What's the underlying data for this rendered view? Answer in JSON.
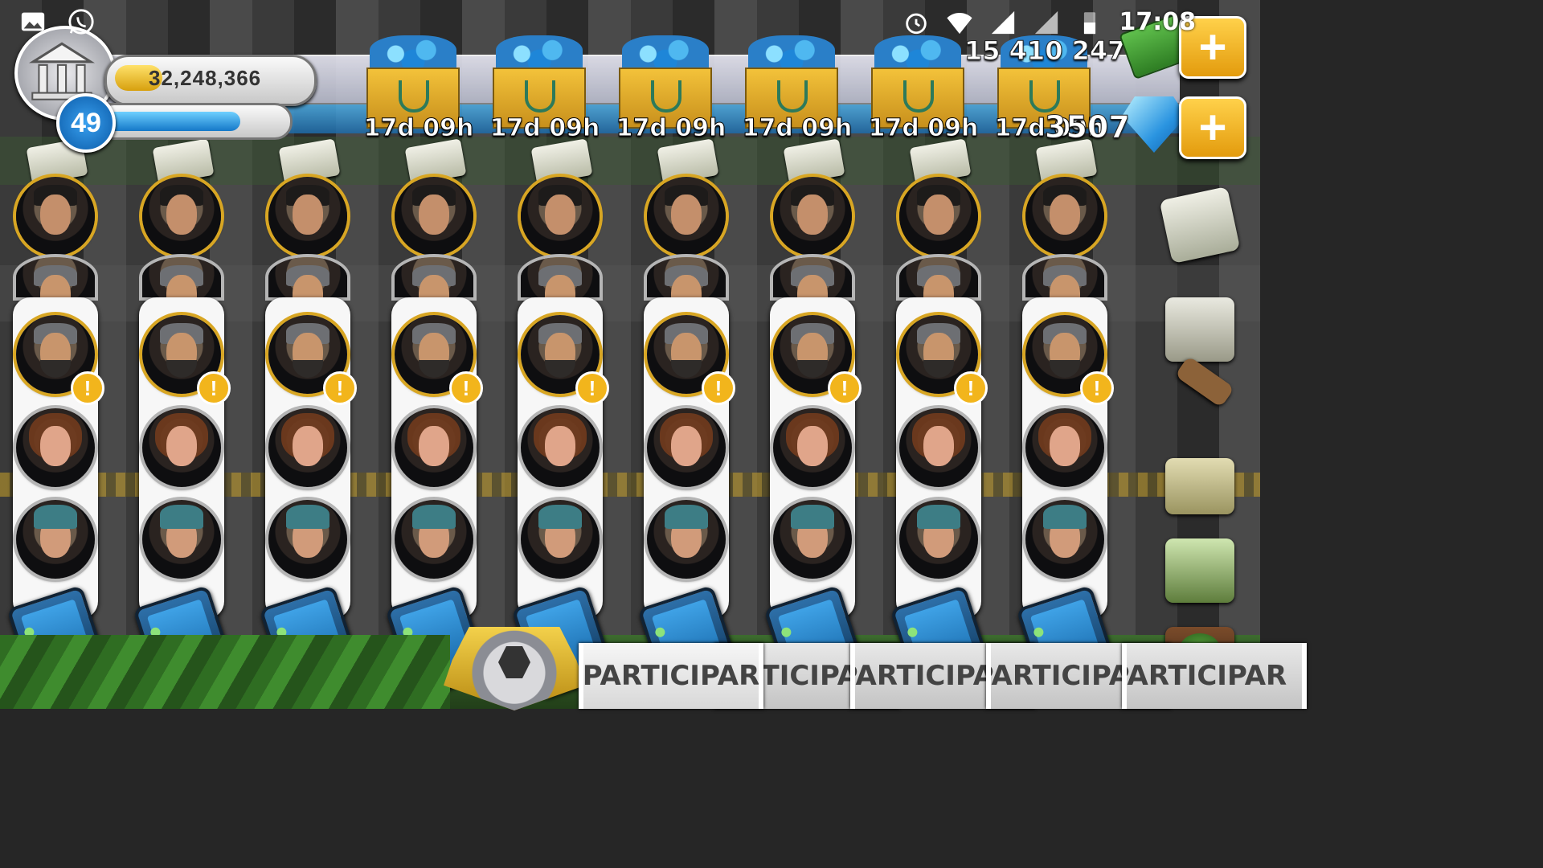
{
  "status_bar": {
    "time": "17:08",
    "left_icons": [
      "gallery-icon",
      "whatsapp-icon"
    ],
    "right_icons": [
      "alarm-icon",
      "wifi-icon",
      "signal-icon",
      "signal-icon-2",
      "battery-icon"
    ]
  },
  "hud": {
    "money": "32,248,366",
    "money_fill": 0.25,
    "level": "49",
    "xp_fill": 0.78,
    "weed": "15 410 247",
    "gems": "3507",
    "plus_label": "+"
  },
  "shop_offers": [
    {
      "timer": "17d 09h"
    },
    {
      "timer": "17d 09h"
    },
    {
      "timer": "17d 09h"
    },
    {
      "timer": "17d 09h"
    },
    {
      "timer": "17d 09h"
    },
    {
      "timer": "17d 09h"
    }
  ],
  "columns_count": 9,
  "alert_symbol": "!",
  "right_icons": [
    "notes-icon",
    "clipboard-icon",
    "hammer-icon",
    "rv-icon",
    "greenhouse-icon",
    "grow-room-icon"
  ],
  "bottom": {
    "tabs": [
      {
        "label": "PARTICIPAR"
      },
      {
        "label": "PARTICIPAR"
      },
      {
        "label": "PARTICIPAR"
      },
      {
        "label": "PARTICIPAR"
      },
      {
        "label": "PARTICIPAR"
      }
    ]
  },
  "colors": {
    "gold": "#d8a623",
    "hud_blue": "#1478c8",
    "plus_orange": "#e39b0d"
  }
}
